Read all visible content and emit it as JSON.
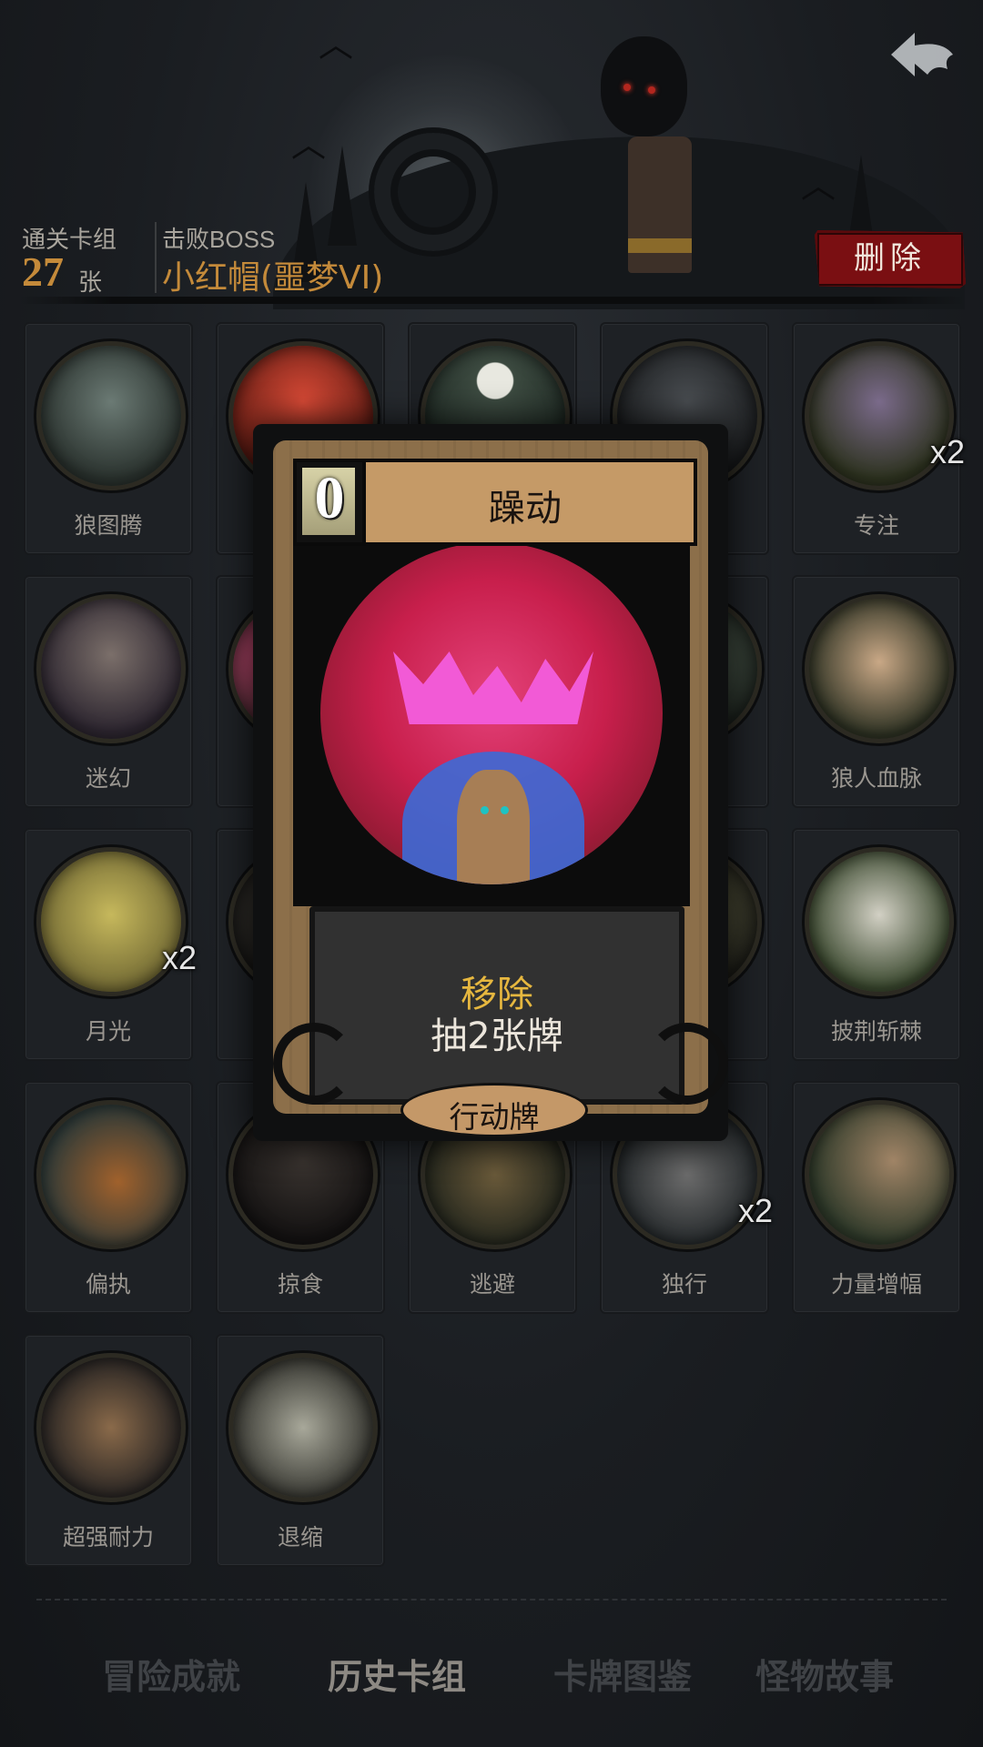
{
  "header": {
    "clear_label": "通关卡组",
    "clear_count": "27",
    "clear_unit": "张",
    "boss_label": "击败BOSS",
    "boss_name": "小红帽(噩梦VI)",
    "delete_label": "删除"
  },
  "cards": [
    {
      "name": "狼图腾",
      "icon": "wolf-totem-art",
      "badge": ""
    },
    {
      "name": "",
      "icon": "red-skull-art",
      "badge": ""
    },
    {
      "name": "",
      "icon": "moon-forest-art",
      "badge": ""
    },
    {
      "name": "",
      "icon": "werewolf-art",
      "badge": ""
    },
    {
      "name": "专注",
      "icon": "wizard-art",
      "badge": "x2"
    },
    {
      "name": "迷幻",
      "icon": "witch-art",
      "badge": ""
    },
    {
      "name": "",
      "icon": "pink-art",
      "badge": ""
    },
    {
      "name": "",
      "icon": "hidden-art",
      "badge": ""
    },
    {
      "name": "",
      "icon": "hidden-art",
      "badge": ""
    },
    {
      "name": "狼人血脉",
      "icon": "clawed-hand-art",
      "badge": ""
    },
    {
      "name": "月光",
      "icon": "full-moon-art",
      "badge": "x2"
    },
    {
      "name": "",
      "icon": "hidden-art",
      "badge": ""
    },
    {
      "name": "",
      "icon": "hidden-art",
      "badge": ""
    },
    {
      "name": "",
      "icon": "hidden-art",
      "badge": ""
    },
    {
      "name": "披荆斩棘",
      "icon": "axe-thorns-art",
      "badge": ""
    },
    {
      "name": "偏执",
      "icon": "bear-wolf-art",
      "badge": ""
    },
    {
      "name": "掠食",
      "icon": "predator-art",
      "badge": ""
    },
    {
      "name": "逃避",
      "icon": "bear-chase-art",
      "badge": ""
    },
    {
      "name": "独行",
      "icon": "lone-walker-art",
      "badge": "x2"
    },
    {
      "name": "力量增幅",
      "icon": "log-carry-art",
      "badge": ""
    },
    {
      "name": "超强耐力",
      "icon": "boy-logs-art",
      "badge": ""
    },
    {
      "name": "退缩",
      "icon": "retreat-art",
      "badge": ""
    }
  ],
  "popup": {
    "cost": "0",
    "title": "躁动",
    "desc_keyword": "移除",
    "desc_text": "抽2张牌",
    "type": "行动牌",
    "icon": "frenzy-art"
  },
  "nav": [
    {
      "label": "冒险成就",
      "active": false
    },
    {
      "label": "历史卡组",
      "active": true
    },
    {
      "label": "卡牌图鉴",
      "active": false
    },
    {
      "label": "怪物故事",
      "active": false
    }
  ],
  "icons": {
    "back": "back-arrow-icon"
  },
  "colors": {
    "accent": "#c48a3a",
    "delete": "#7a0f12",
    "keyword": "#e6b73f"
  }
}
